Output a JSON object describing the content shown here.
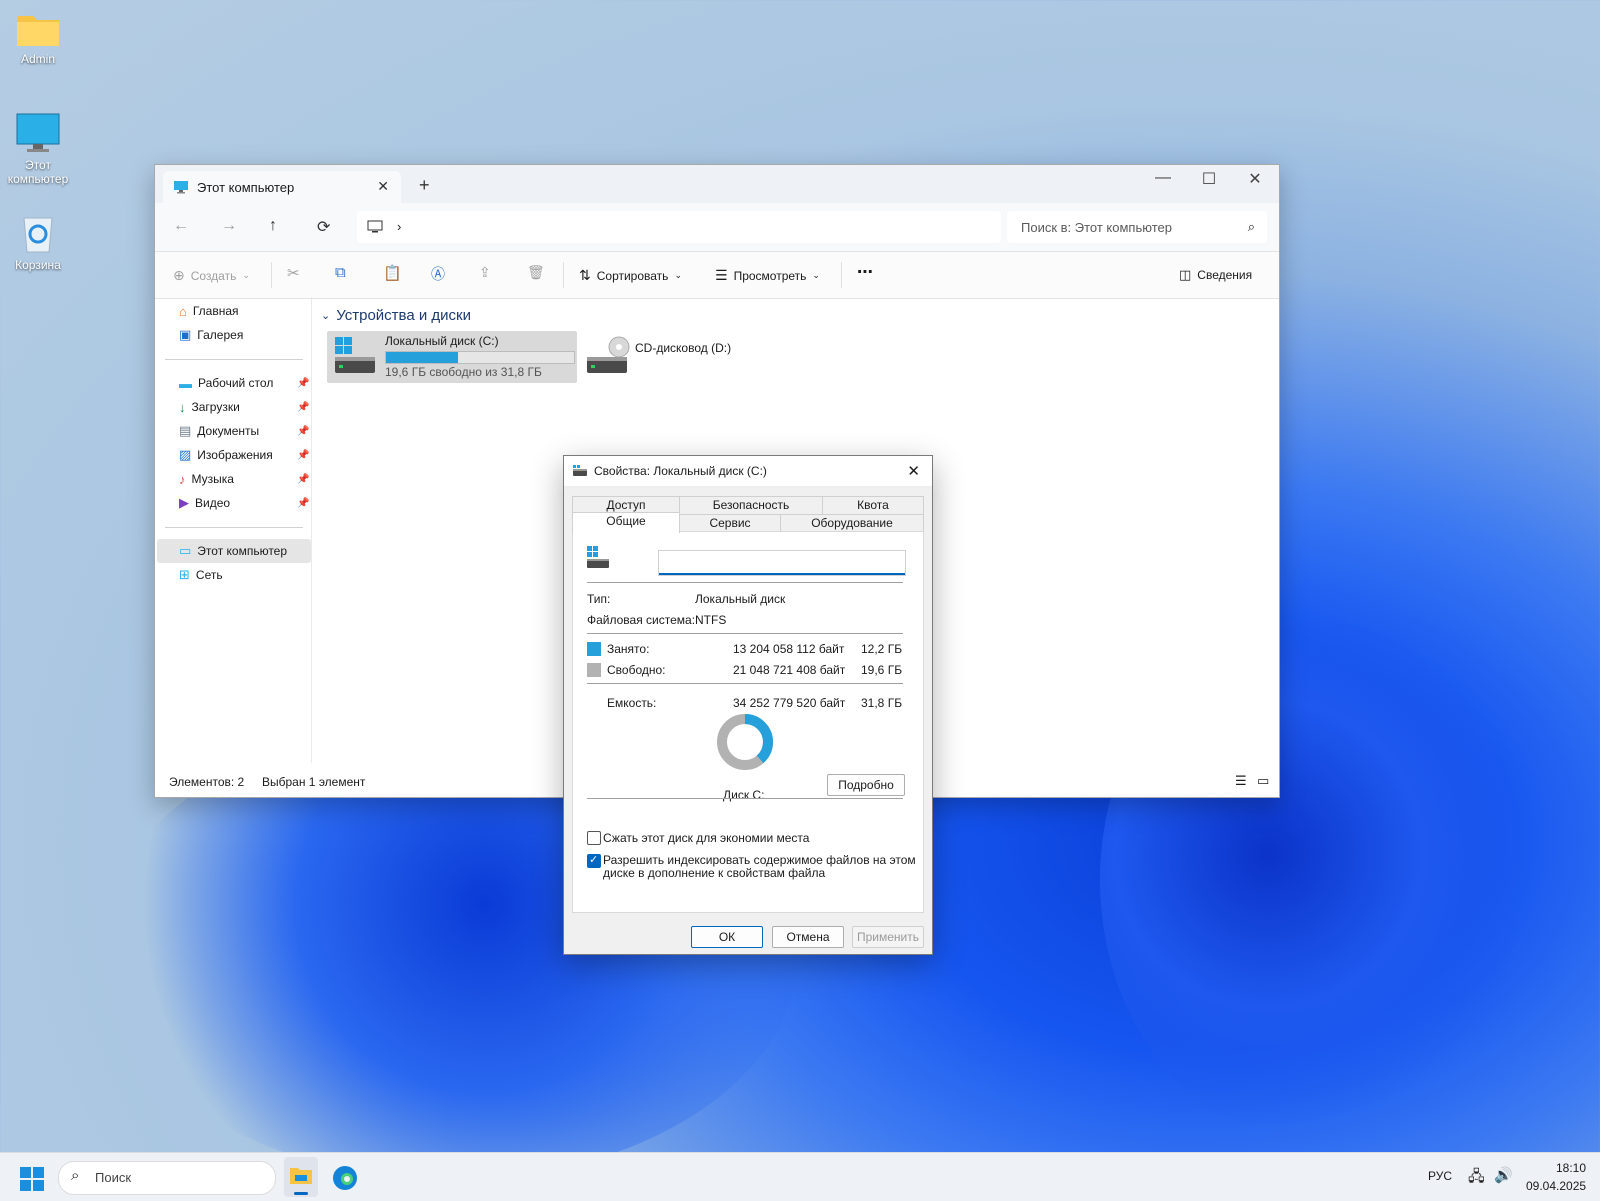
{
  "desktop": {
    "icons": [
      {
        "label": "Admin"
      },
      {
        "label": "Этот компьютер"
      },
      {
        "label": "Корзина"
      }
    ]
  },
  "explorer": {
    "tab_title": "Этот компьютер",
    "search_placeholder": "Поиск в: Этот компьютер",
    "toolbar": {
      "create": "Создать",
      "sort": "Сортировать",
      "view": "Просмотреть",
      "details": "Сведения"
    },
    "nav": {
      "home": "Главная",
      "gallery": "Галерея",
      "desktop": "Рабочий стол",
      "downloads": "Загрузки",
      "documents": "Документы",
      "pictures": "Изображения",
      "music": "Музыка",
      "videos": "Видео",
      "this_pc": "Этот компьютер",
      "network": "Сеть"
    },
    "section_title": "Устройства и диски",
    "drives": [
      {
        "name": "Локальный диск (C:)",
        "usage_text": "19,6 ГБ свободно из 31,8 ГБ",
        "used_fraction": 0.385
      },
      {
        "name": "CD-дисковод (D:)"
      }
    ],
    "status": {
      "items": "Элементов: 2",
      "selected": "Выбран 1 элемент"
    }
  },
  "dialog": {
    "title": "Свойства: Локальный диск (C:)",
    "tabs_top": [
      "Доступ",
      "Безопасность",
      "Квота"
    ],
    "tabs_bottom": [
      "Общие",
      "Сервис",
      "Оборудование"
    ],
    "type_label": "Тип:",
    "type_value": "Локальный диск",
    "fs_label": "Файловая система:",
    "fs_value": "NTFS",
    "used_label": "Занято:",
    "used_bytes": "13 204 058 112 байт",
    "used_gb": "12,2 ГБ",
    "free_label": "Свободно:",
    "free_bytes": "21 048 721 408 байт",
    "free_gb": "19,6 ГБ",
    "capacity_label": "Емкость:",
    "capacity_bytes": "34 252 779 520 байт",
    "capacity_gb": "31,8 ГБ",
    "used_fraction": 0.385,
    "disk_label": "Диск C:",
    "details_btn": "Подробно",
    "compress_label": "Сжать этот диск для экономии места",
    "index_label_1": "Разрешить индексировать содержимое файлов на этом",
    "index_label_2": "диске в дополнение к свойствам файла",
    "ok": "ОК",
    "cancel": "Отмена",
    "apply": "Применить",
    "colors": {
      "used": "#26a0da",
      "free": "#b2b2b2"
    }
  },
  "taskbar": {
    "search": "Поиск",
    "lang": "РУС",
    "time": "18:10",
    "date": "09.04.2025"
  }
}
